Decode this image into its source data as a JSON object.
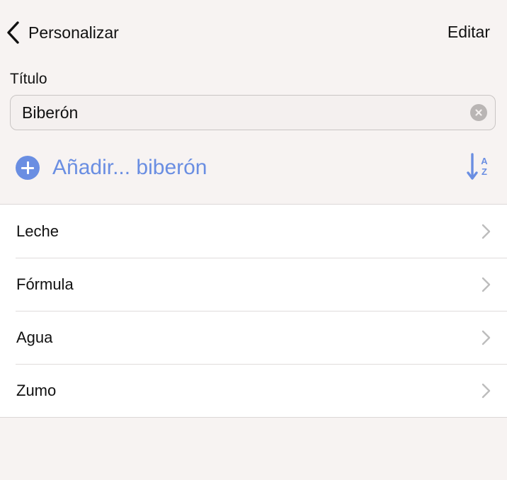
{
  "nav": {
    "back_label": "Personalizar",
    "edit_label": "Editar"
  },
  "title_field": {
    "label": "Título",
    "value": "Biberón"
  },
  "add_button": {
    "label": "Añadir... biberón"
  },
  "sort": {
    "icon": "sort-az-icon",
    "top_letter": "A",
    "bottom_letter": "Z"
  },
  "items": [
    {
      "label": "Leche"
    },
    {
      "label": "Fórmula"
    },
    {
      "label": "Agua"
    },
    {
      "label": "Zumo"
    }
  ],
  "colors": {
    "accent": "#6a8ee2",
    "background": "#f7f3f2",
    "list_background": "#ffffff",
    "chevron": "#bdbdbd"
  }
}
